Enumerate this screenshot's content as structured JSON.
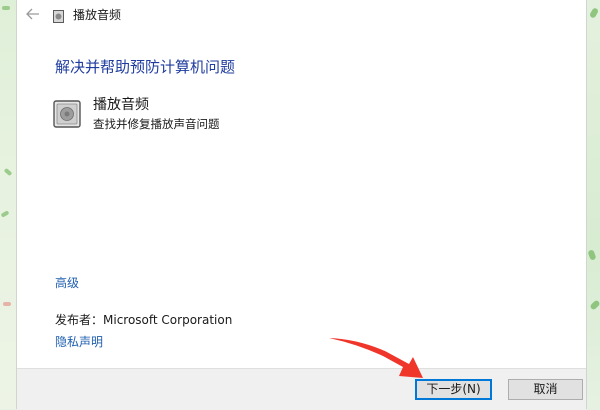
{
  "window": {
    "title": "播放音频"
  },
  "main": {
    "heading": "解决并帮助预防计算机问题",
    "item": {
      "title": "播放音频",
      "description": "查找并修复播放声音问题",
      "icon": "audio-troubleshooter-icon"
    },
    "advanced_link": "高级",
    "publisher": "发布者：Microsoft Corporation",
    "privacy_link": "隐私声明"
  },
  "footer": {
    "next_label": "下一步(N)",
    "cancel_label": "取消"
  },
  "annotation": {
    "arrow_color": "#f0362b"
  },
  "colors": {
    "heading": "#1f3c9e",
    "link": "#1f5fb0",
    "focus_border": "#0078d7"
  },
  "icons": [
    "back-arrow-icon",
    "app-icon",
    "audio-troubleshooter-icon"
  ]
}
